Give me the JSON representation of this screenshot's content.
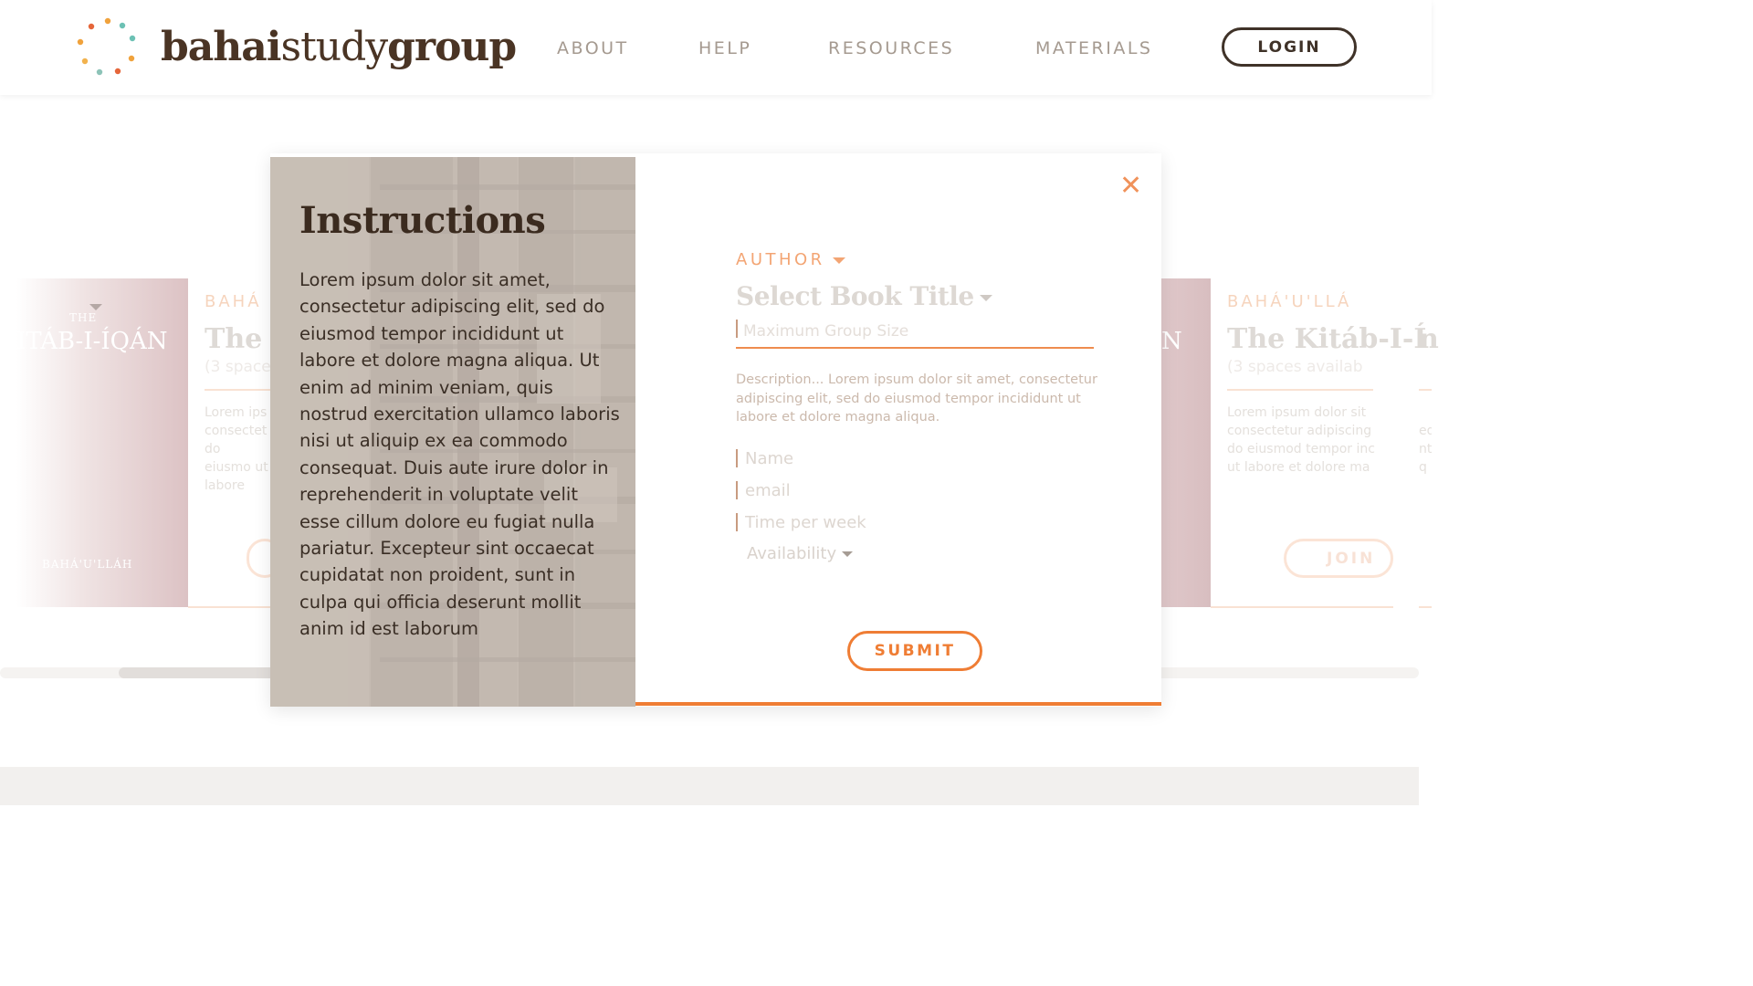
{
  "header": {
    "logo": {
      "bold_a": "bahai",
      "light": "study",
      "bold_b": "group"
    },
    "nav": [
      "ABOUT",
      "HELP",
      "RESOURCES",
      "MATERIALS"
    ],
    "login_label": "LOGIN"
  },
  "background": {
    "left_cover": {
      "title": "ITÁB-I-ÍQÁN",
      "small_top": "THE",
      "small_bottom": "BAHÁ'U'LLÁH"
    },
    "left_card": {
      "author": "BAHÁ",
      "title": "The K",
      "spaces": "(3 space",
      "desc": "Lorem ips consectet do eiusmo ut labore"
    },
    "right_cover": {
      "title": "N"
    },
    "right_card": {
      "author": "BAHÁ'U'LLÁ",
      "title": "The Kitáb-I-Í",
      "spaces": "(3 spaces availab",
      "desc": "Lorem ipsum dolor sit consectetur adipiscing do eiusmod tempor inc ut labore et dolore ma",
      "join": "JOIN"
    },
    "far_right": {
      "title": "n",
      "desc": "ed nt q"
    }
  },
  "modal": {
    "instructions_title": "Instructions",
    "instructions_body": "Lorem ipsum dolor sit amet, consectetur adipiscing elit, sed do eiusmod tempor incididunt ut labore et dolore magna aliqua. Ut enim ad minim veniam, quis nostrud exercitation ullamco laboris nisi ut aliquip ex ea commodo consequat. Duis aute irure dolor in reprehenderit in voluptate velit esse cillum dolore eu fugiat nulla pariatur. Excepteur sint occaecat cupidatat non proident, sunt in culpa qui officia deserunt mollit anim id est laborum",
    "close_symbol": "✕",
    "author_label": "AUTHOR",
    "book_title_label": "Select Book Title",
    "max_group_placeholder": "Maximum Group Size",
    "description": "Description... Lorem ipsum dolor sit amet, consectetur adipiscing elit, sed do eiusmod tempor incididunt ut labore et dolore magna aliqua.",
    "name_placeholder": "Name",
    "email_placeholder": "email",
    "time_placeholder": "Time per week",
    "availability_label": "Availability",
    "submit_label": "SUBMIT"
  },
  "colors": {
    "accent": "#ef7d34",
    "brand_text": "#4a3424",
    "nav_text": "#a59a90",
    "logo_dots": [
      "#f0a23c",
      "#6cc1b4",
      "#e5663a",
      "#8dc3b8",
      "#f2b24d"
    ]
  },
  "icons": [
    "logo-dots-icon",
    "close-icon",
    "chevron-down-icon"
  ]
}
